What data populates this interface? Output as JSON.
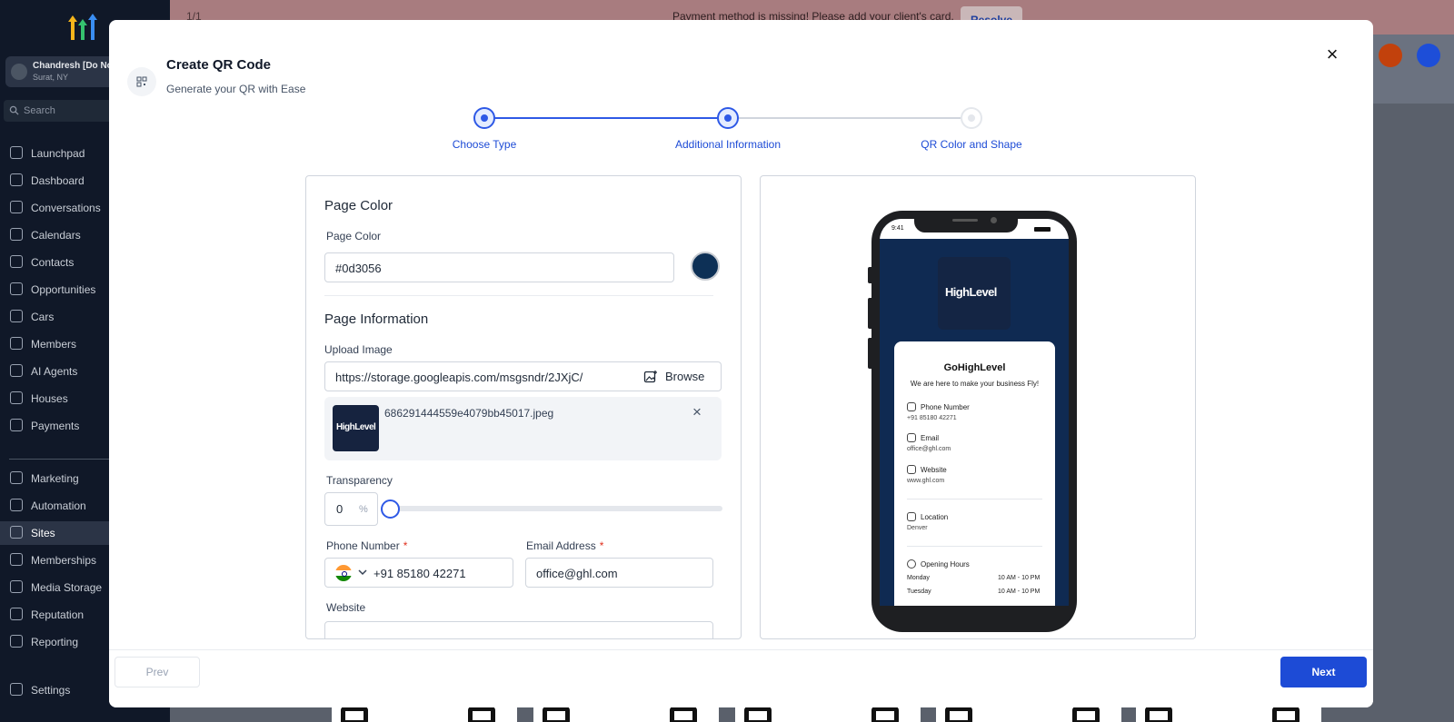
{
  "topbar": {
    "pager": "1/1",
    "banner": "Payment method is missing! Please add your client's card.",
    "resolve_label": "Resolve"
  },
  "account": {
    "name": "Chandresh [Do No",
    "location": "Surat, NY"
  },
  "sidebar": {
    "search_placeholder": "Search",
    "items": [
      {
        "label": "Launchpad",
        "icon": "rocket-icon"
      },
      {
        "label": "Dashboard",
        "icon": "dashboard-icon"
      },
      {
        "label": "Conversations",
        "icon": "chat-icon"
      },
      {
        "label": "Calendars",
        "icon": "calendar-icon"
      },
      {
        "label": "Contacts",
        "icon": "contacts-icon"
      },
      {
        "label": "Opportunities",
        "icon": "opportunities-icon"
      },
      {
        "label": "Cars",
        "icon": "box-icon"
      },
      {
        "label": "Members",
        "icon": "box-icon"
      },
      {
        "label": "AI Agents",
        "icon": "sparkle-icon"
      },
      {
        "label": "Houses",
        "icon": "house-icon"
      },
      {
        "label": "Payments",
        "icon": "receipt-icon"
      },
      {
        "label": "Marketing",
        "icon": "send-icon"
      },
      {
        "label": "Automation",
        "icon": "automation-icon"
      },
      {
        "label": "Sites",
        "icon": "sites-icon"
      },
      {
        "label": "Memberships",
        "icon": "memberships-icon"
      },
      {
        "label": "Media Storage",
        "icon": "image-icon"
      },
      {
        "label": "Reputation",
        "icon": "star-icon"
      },
      {
        "label": "Reporting",
        "icon": "chart-icon"
      },
      {
        "label": "Settings",
        "icon": "gear-icon"
      }
    ],
    "active": "Sites"
  },
  "modal": {
    "title": "Create QR Code",
    "subtitle": "Generate your QR with Ease",
    "close_icon": "close-icon",
    "steps": [
      {
        "label": "Choose Type",
        "state": "done"
      },
      {
        "label": "Additional Information",
        "state": "current"
      },
      {
        "label": "QR Color and Shape",
        "state": "upcoming"
      }
    ],
    "form": {
      "page_color_heading": "Page Color",
      "page_color_label": "Page Color",
      "page_color_value": "#0d3056",
      "page_info_heading": "Page Information",
      "upload_label": "Upload Image",
      "upload_value": "https://storage.googleapis.com/msgsndr/2JXjC/",
      "browse_label": "Browse",
      "file_name": "686291444559e4079bb45017.jpeg",
      "thumb_brand": "HighLevel",
      "transparency_label": "Transparency",
      "transparency_value": "0",
      "transparency_unit": "%",
      "transparency_level": 0,
      "phone_label": "Phone Number",
      "phone_value": "+91 85180 42271",
      "email_label": "Email Address",
      "email_value": "office@ghl.com",
      "website_label": "Website",
      "required_mark": "*"
    },
    "preview": {
      "status_time": "9:41",
      "brand": "HighLevel",
      "business_name": "GoHighLevel",
      "tagline": "We are here to make your business Fly!",
      "phone_label": "Phone Number",
      "phone_value": "+91 85180 42271",
      "email_label": "Email",
      "email_value": "office@ghl.com",
      "website_label": "Website",
      "website_value": "www.ghl.com",
      "location_label": "Location",
      "location_value": "Denver",
      "hours_label": "Opening Hours",
      "hours": [
        {
          "day": "Monday",
          "time": "10 AM - 10 PM"
        },
        {
          "day": "Tuesday",
          "time": "10 AM - 10 PM"
        }
      ]
    },
    "footer": {
      "prev_label": "Prev",
      "next_label": "Next"
    }
  },
  "colors": {
    "accent": "#1d4bd6",
    "page_color": "#0d3056",
    "sidebar": "#101828"
  }
}
